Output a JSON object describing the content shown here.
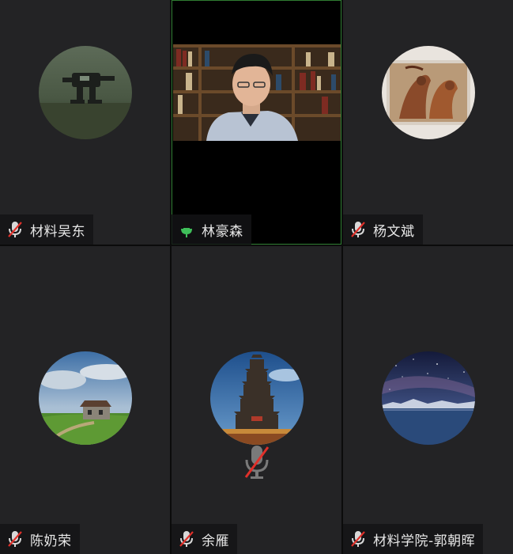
{
  "participants": [
    {
      "name": "材料吴东",
      "muted": true,
      "avatar": "mech-robot-image"
    },
    {
      "name": "林豪森",
      "muted": false,
      "speaking": true,
      "video": "bookshelf-speaker-video"
    },
    {
      "name": "杨文斌",
      "muted": true,
      "avatar": "horses-painting-image"
    },
    {
      "name": "陈奶荣",
      "muted": true,
      "avatar": "farmhouse-landscape-image"
    },
    {
      "name": "余雁",
      "muted": true,
      "avatar": "pagoda-image"
    },
    {
      "name": "材料学院-郭朝晖",
      "muted": true,
      "avatar": "starry-lake-image"
    }
  ],
  "colors": {
    "tile_bg": "#232325",
    "active_border": "#2f7d32",
    "speaking_green": "#3fbf5a",
    "muted_red": "#e0302a"
  }
}
